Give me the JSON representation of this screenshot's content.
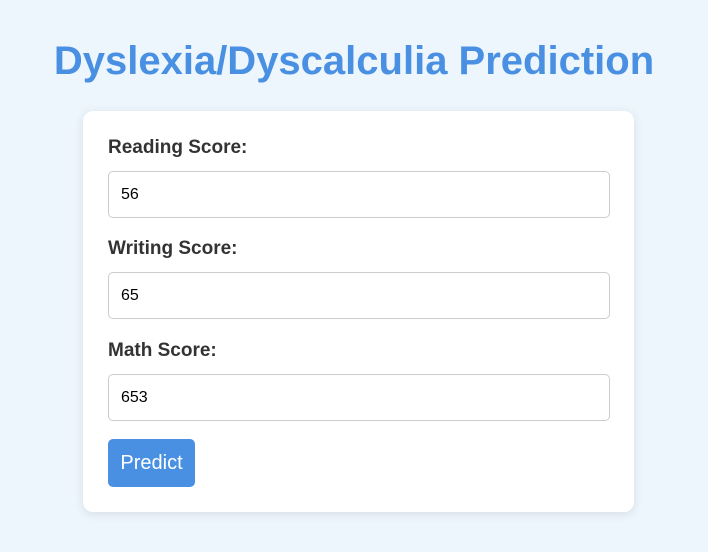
{
  "header": {
    "title": "Dyslexia/Dyscalculia Prediction"
  },
  "form": {
    "fields": [
      {
        "label": "Reading Score:",
        "value": "56"
      },
      {
        "label": "Writing Score:",
        "value": "65"
      },
      {
        "label": "Math Score:",
        "value": "653"
      }
    ],
    "submit_label": "Predict"
  },
  "colors": {
    "accent": "#4a90e2",
    "background": "#eef6fd",
    "card": "#ffffff",
    "label_text": "#333333"
  }
}
